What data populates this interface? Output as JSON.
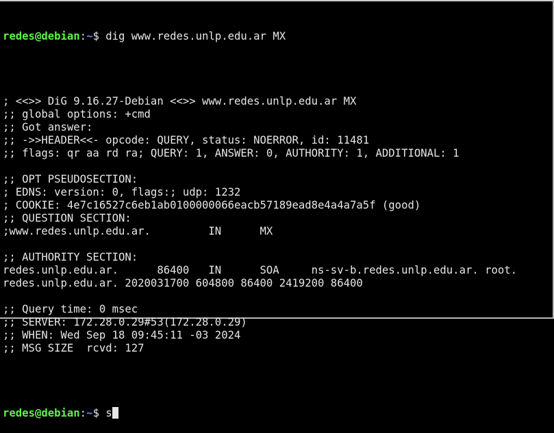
{
  "prompt": {
    "user_host": "redes@debian",
    "colon": ":",
    "path": "~",
    "symbol": "$ "
  },
  "first_command": "dig www.redes.unlp.edu.ar MX",
  "output_lines": [
    "",
    "; <<>> DiG 9.16.27-Debian <<>> www.redes.unlp.edu.ar MX",
    ";; global options: +cmd",
    ";; Got answer:",
    ";; ->>HEADER<<- opcode: QUERY, status: NOERROR, id: 11481",
    ";; flags: qr aa rd ra; QUERY: 1, ANSWER: 0, AUTHORITY: 1, ADDITIONAL: 1",
    "",
    ";; OPT PSEUDOSECTION:",
    "; EDNS: version: 0, flags:; udp: 1232",
    "; COOKIE: 4e7c16527c6eb1ab0100000066eacb57189ead8e4a4a7a5f (good)",
    ";; QUESTION SECTION:",
    ";www.redes.unlp.edu.ar.         IN      MX",
    "",
    ";; AUTHORITY SECTION:",
    "redes.unlp.edu.ar.      86400   IN      SOA     ns-sv-b.redes.unlp.edu.ar. root.",
    "redes.unlp.edu.ar. 2020031700 604800 86400 2419200 86400",
    "",
    ";; Query time: 0 msec",
    ";; SERVER: 172.28.0.29#53(172.28.0.29)",
    ";; WHEN: Wed Sep 18 09:45:11 -03 2024",
    ";; MSG SIZE  rcvd: 127",
    ""
  ],
  "current_input": "s"
}
